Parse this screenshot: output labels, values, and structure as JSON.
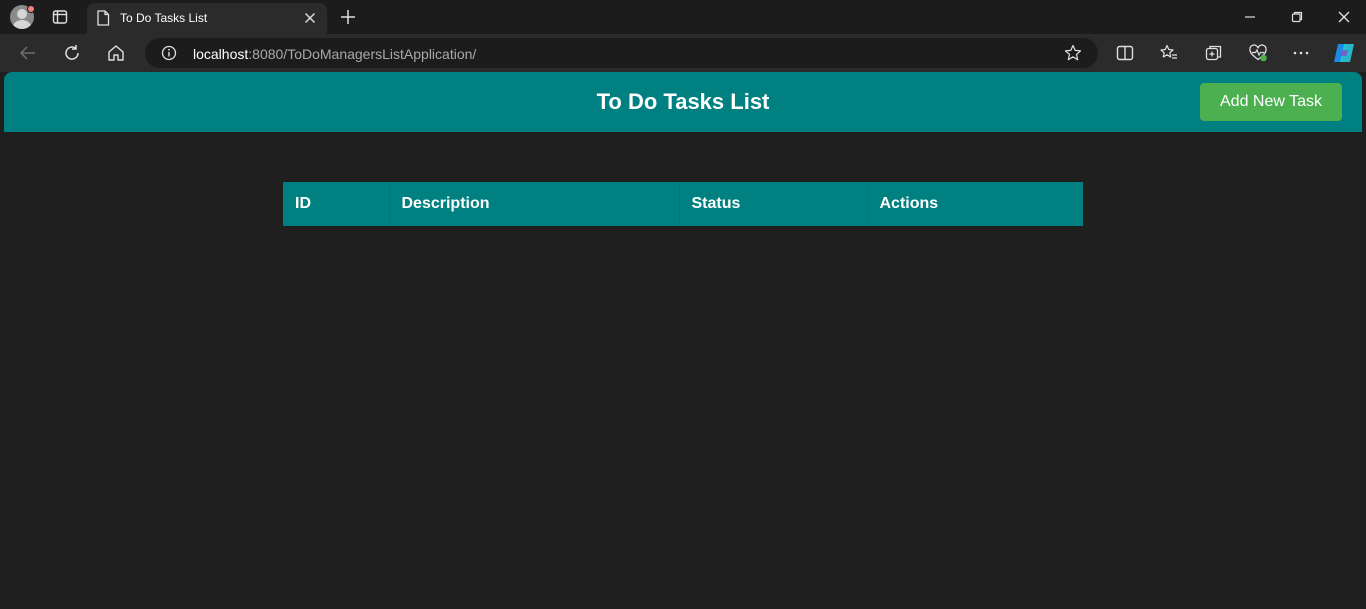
{
  "browser": {
    "tab_title": "To Do Tasks List",
    "url_host": "localhost",
    "url_rest": ":8080/ToDoManagersListApplication/"
  },
  "app": {
    "title": "To Do Tasks List",
    "add_button_label": "Add New Task",
    "accent_color": "#008080",
    "button_color": "#4caf50"
  },
  "table": {
    "columns": [
      "ID",
      "Description",
      "Status",
      "Actions"
    ],
    "rows": []
  }
}
